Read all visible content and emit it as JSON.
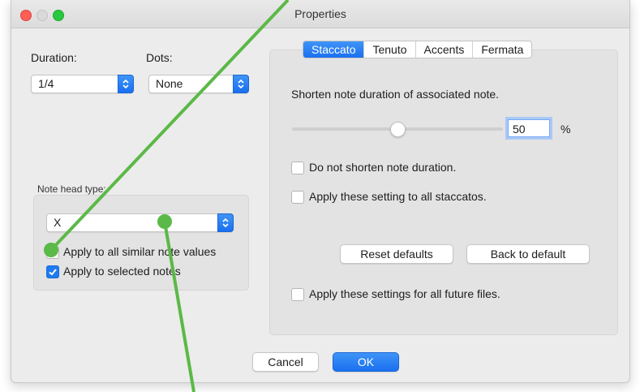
{
  "window": {
    "title": "Properties"
  },
  "left": {
    "duration_label": "Duration:",
    "duration_value": "1/4",
    "dots_label": "Dots:",
    "dots_value": "None",
    "note_head_label": "Note head type:",
    "note_head_value": "X",
    "apply_similar_label": "Apply to all similar note values",
    "apply_similar_checked": false,
    "apply_selected_label": "Apply to selected notes",
    "apply_selected_checked": true
  },
  "right": {
    "tabs": [
      {
        "label": "Staccato",
        "active": true
      },
      {
        "label": "Tenuto",
        "active": false
      },
      {
        "label": "Accents",
        "active": false
      },
      {
        "label": "Fermata",
        "active": false
      }
    ],
    "description": "Shorten note duration of associated note.",
    "slider_percent": 50,
    "value_field": "50",
    "percent_unit": "%",
    "no_shorten_label": "Do not shorten note duration.",
    "no_shorten_checked": false,
    "apply_all_staccatos_label": "Apply these setting to all staccatos.",
    "apply_all_staccatos_checked": false,
    "reset_defaults_label": "Reset defaults",
    "back_to_default_label": "Back to default",
    "future_files_label": "Apply these settings for all future files.",
    "future_files_checked": false
  },
  "footer": {
    "cancel_label": "Cancel",
    "ok_label": "OK"
  },
  "colors": {
    "accent": "#1f7bf1",
    "annotation_green": "#5bb947"
  }
}
